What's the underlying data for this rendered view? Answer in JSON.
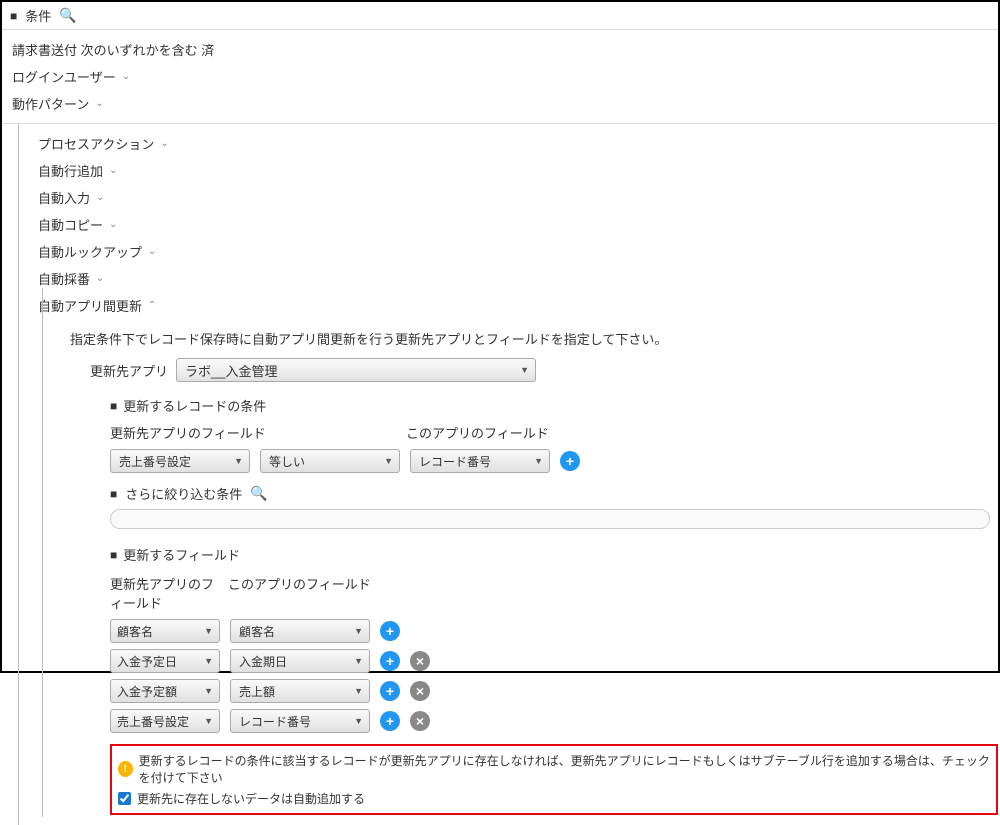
{
  "header": {
    "title": "条件"
  },
  "filters": {
    "line1": "請求書送付 次のいずれかを含む 済",
    "login_user": "ログインユーザー",
    "behavior_pattern": "動作パターン"
  },
  "tree": {
    "process_action": "プロセスアクション",
    "auto_row_add": "自動行追加",
    "auto_input": "自動入力",
    "auto_copy": "自動コピー",
    "auto_lookup": "自動ルックアップ",
    "auto_number": "自動採番",
    "auto_app_update": "自動アプリ間更新"
  },
  "update": {
    "instruction": "指定条件下でレコード保存時に自動アプリ間更新を行う更新先アプリとフィールドを指定して下さい。",
    "target_app_label": "更新先アプリ",
    "target_app_value": "ラボ__入金管理",
    "record_condition_title": "更新するレコードの条件",
    "target_field_header": "更新先アプリのフィールド",
    "this_field_header": "このアプリのフィールド",
    "cond_field": "売上番号設定",
    "cond_op": "等しい",
    "cond_value": "レコード番号",
    "more_filter": "さらに絞り込む条件",
    "update_fields_title": "更新するフィールド",
    "field_hdr1": "更新先アプリのフィールド",
    "field_hdr2": "このアプリのフィールド",
    "mappings": [
      {
        "left": "顧客名",
        "right": "顧客名",
        "deletable": false
      },
      {
        "left": "入金予定日",
        "right": "入金期日",
        "deletable": true
      },
      {
        "left": "入金予定額",
        "right": "売上額",
        "deletable": true
      },
      {
        "left": "売上番号設定",
        "right": "レコード番号",
        "deletable": true
      }
    ],
    "warning": "更新するレコードの条件に該当するレコードが更新先アプリに存在しなければ、更新先アプリにレコードもしくはサブテーブル行を追加する場合は、チェックを付けて下さい",
    "checkbox_label": "更新先に存在しないデータは自動追加する"
  }
}
